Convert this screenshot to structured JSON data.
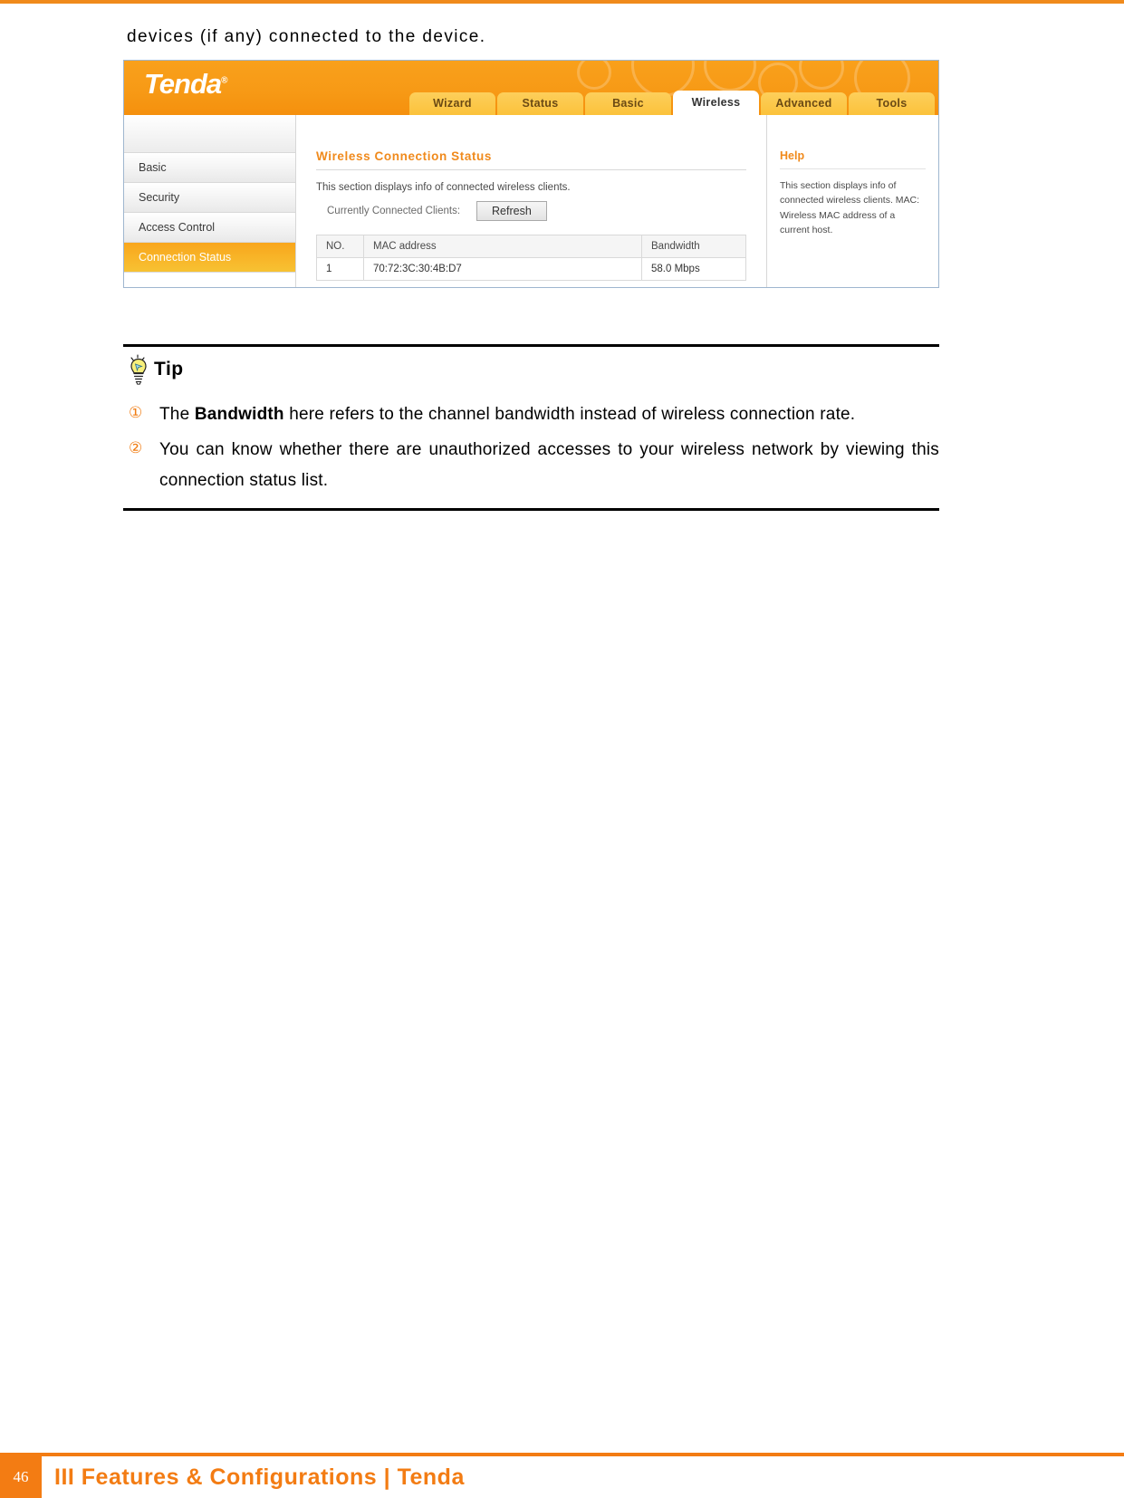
{
  "document": {
    "intro_text": "devices (if any) connected to the device.",
    "footer": {
      "page_number": "46",
      "footer_text": "III Features & Configurations | Tenda",
      "accent_color": "#f37c13"
    }
  },
  "router_ui": {
    "brand": "Tenda",
    "brand_trademark": "®",
    "tabs": [
      {
        "label": "Wizard",
        "active": false
      },
      {
        "label": "Status",
        "active": false
      },
      {
        "label": "Basic",
        "active": false
      },
      {
        "label": "Wireless",
        "active": true
      },
      {
        "label": "Advanced",
        "active": false
      },
      {
        "label": "Tools",
        "active": false
      }
    ],
    "sidebar": {
      "items": [
        {
          "label": "Basic",
          "active": false
        },
        {
          "label": "Security",
          "active": false
        },
        {
          "label": "Access Control",
          "active": false
        },
        {
          "label": "Connection Status",
          "active": true
        }
      ]
    },
    "main": {
      "section_title": "Wireless Connection Status",
      "section_description": "This section displays info of connected wireless clients.",
      "clients_label": "Currently Connected Clients:",
      "refresh_button": "Refresh",
      "table": {
        "headers": [
          "NO.",
          "MAC address",
          "Bandwidth"
        ],
        "rows": [
          {
            "no": "1",
            "mac": "70:72:3C:30:4B:D7",
            "bandwidth": "58.0 Mbps"
          }
        ]
      }
    },
    "help": {
      "title": "Help",
      "text": "This section displays info of connected wireless clients. MAC: Wireless MAC address of a current host."
    },
    "accent_color": "#f08a1c"
  },
  "tip": {
    "heading": "Tip",
    "items": [
      {
        "marker": "①",
        "prefix": "The ",
        "bold": "Bandwidth",
        "suffix": " here refers to the channel bandwidth instead of wireless connection rate."
      },
      {
        "marker": "②",
        "prefix": "",
        "bold": "",
        "suffix": "You can know whether there are unauthorized accesses to your wireless network by viewing this connection status list."
      }
    ]
  }
}
